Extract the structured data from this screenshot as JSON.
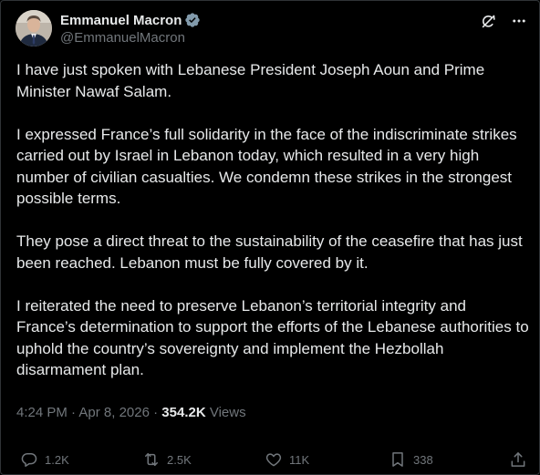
{
  "author": {
    "display_name": "Emmanuel Macron",
    "handle": "@EmmanuelMacron",
    "verified_icon": "verified-badge-icon"
  },
  "header_actions": {
    "grok_icon": "grok-icon",
    "more_icon": "more-options-icon"
  },
  "body": {
    "paragraphs": [
      "I have just spoken with Lebanese President Joseph Aoun and Prime Minister Nawaf Salam.",
      "I expressed France’s full solidarity in the face of the indiscriminate strikes carried out by Israel in Lebanon today, which resulted in a very high number of civilian casualties. We condemn these strikes in the strongest possible terms.",
      "They pose a direct threat to the sustainability of the ceasefire that has just been reached. Lebanon must be fully covered by it.",
      "I reiterated the need to preserve Lebanon’s territorial integrity and France’s determination to support the efforts of the Lebanese authorities to uphold the country’s sovereignty and implement the Hezbollah disarmament plan."
    ]
  },
  "meta": {
    "time": "4:24 PM",
    "separator": "·",
    "date": "Apr 8, 2026",
    "views_count": "354.2K",
    "views_label": "Views"
  },
  "actions": {
    "replies": "1.2K",
    "reposts": "2.5K",
    "likes": "11K",
    "bookmarks": "338"
  },
  "colors": {
    "background": "#000000",
    "text": "#e7e9ea",
    "muted": "#71767b",
    "verified": "#829aab",
    "border": "#2f3336"
  }
}
